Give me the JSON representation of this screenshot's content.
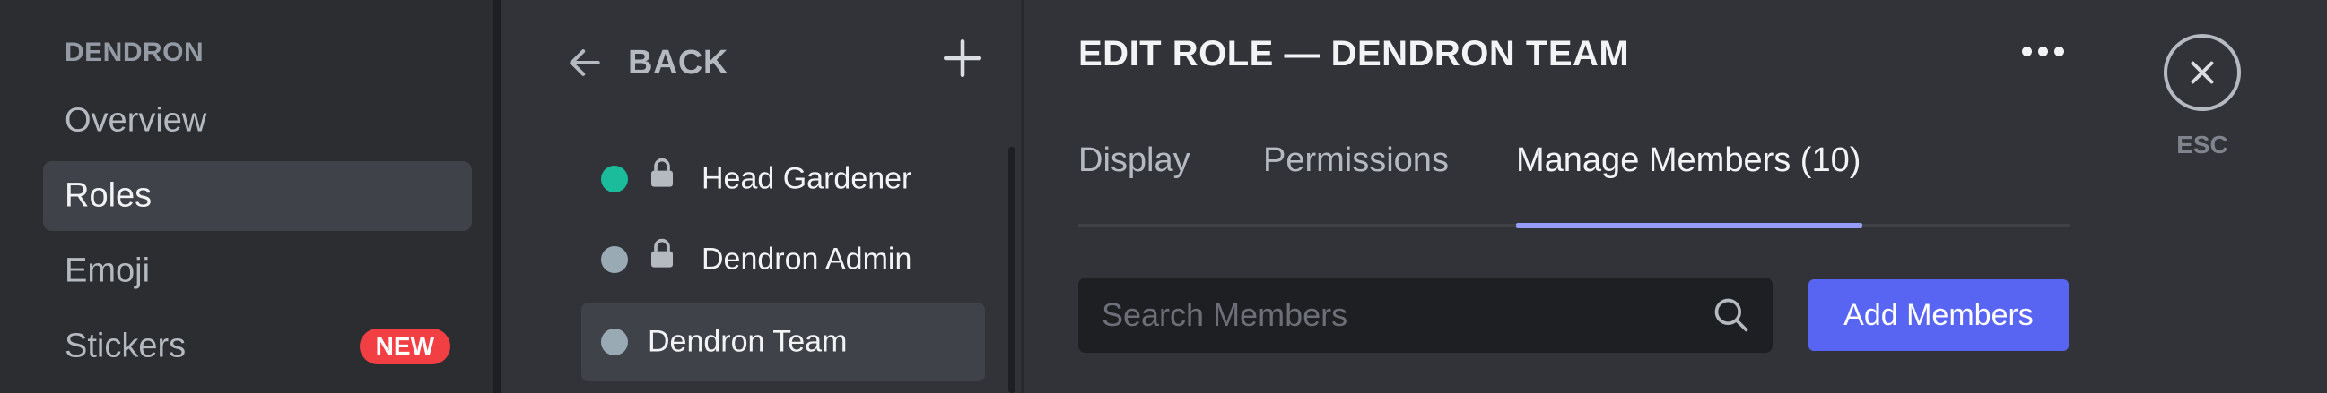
{
  "sidebar": {
    "section_header": "DENDRON",
    "items": [
      {
        "label": "Overview",
        "selected": false
      },
      {
        "label": "Roles",
        "selected": true
      },
      {
        "label": "Emoji",
        "selected": false
      },
      {
        "label": "Stickers",
        "selected": false,
        "badge": "NEW"
      }
    ]
  },
  "roles_panel": {
    "back_label": "BACK",
    "add_icon": "plus-icon",
    "roles": [
      {
        "name": "Head Gardener",
        "color": "#1abc9c",
        "locked": true,
        "selected": false
      },
      {
        "name": "Dendron Admin",
        "color": "#99aab5",
        "locked": true,
        "selected": false
      },
      {
        "name": "Dendron Team",
        "color": "#99aab5",
        "locked": false,
        "selected": true
      }
    ]
  },
  "main": {
    "title": "EDIT ROLE — DENDRON TEAM",
    "tabs": [
      {
        "label": "Display",
        "active": false
      },
      {
        "label": "Permissions",
        "active": false
      },
      {
        "label": "Manage Members (10)",
        "active": true
      }
    ],
    "search": {
      "placeholder": "Search Members",
      "value": ""
    },
    "add_members_label": "Add Members"
  },
  "close": {
    "label": "ESC"
  },
  "colors": {
    "accent": "#5865f2",
    "tab_indicator": "#949cf7",
    "badge": "#f23f43"
  }
}
